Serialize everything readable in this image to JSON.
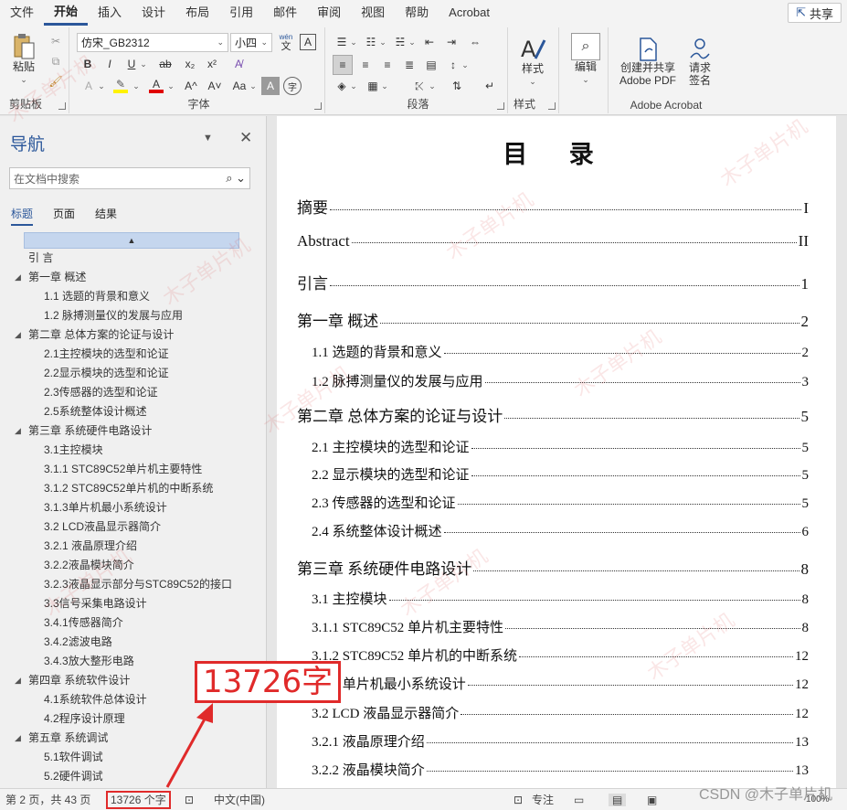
{
  "menubar": {
    "items": [
      "文件",
      "开始",
      "插入",
      "设计",
      "布局",
      "引用",
      "邮件",
      "审阅",
      "视图",
      "帮助",
      "Acrobat"
    ],
    "active": "开始",
    "share_label": "共享"
  },
  "ribbon": {
    "clipboard": {
      "paste_label": "粘贴",
      "group_label": "剪贴板"
    },
    "font": {
      "family": "仿宋_GB2312",
      "size": "小四",
      "group_label": "字体",
      "wen_label": "wén",
      "wen_char": "文",
      "a_box": "A",
      "bold": "B",
      "italic": "I",
      "underline": "U",
      "strike": "ab",
      "sub": "x₂",
      "sup": "x²",
      "grow": "A^",
      "shrink": "A˅",
      "case": "Aa",
      "clear": "A",
      "highlight": "ab",
      "color": "A",
      "char_shade": "A",
      "enclose": "字"
    },
    "paragraph": {
      "group_label": "段落"
    },
    "styles": {
      "label": "样式",
      "group_label": "样式"
    },
    "editing": {
      "label": "编辑"
    },
    "adobe": {
      "create_label_1": "创建并共享",
      "create_label_2": "Adobe PDF",
      "sign_label_1": "请求",
      "sign_label_2": "签名",
      "group_label": "Adobe Acrobat"
    }
  },
  "nav": {
    "title": "导航",
    "search_placeholder": "在文档中搜索",
    "tabs": [
      "标题",
      "页面",
      "结果"
    ],
    "items": [
      {
        "label": "引 言",
        "level": 1,
        "collapsible": false
      },
      {
        "label": "第一章 概述",
        "level": 1,
        "collapsible": true
      },
      {
        "label": "1.1 选题的背景和意义",
        "level": 2,
        "collapsible": false
      },
      {
        "label": "1.2 脉搏测量仪的发展与应用",
        "level": 2,
        "collapsible": false
      },
      {
        "label": "第二章 总体方案的论证与设计",
        "level": 1,
        "collapsible": true
      },
      {
        "label": "2.1主控模块的选型和论证",
        "level": 2,
        "collapsible": false
      },
      {
        "label": "2.2显示模块的选型和论证",
        "level": 2,
        "collapsible": false
      },
      {
        "label": "2.3传感器的选型和论证",
        "level": 2,
        "collapsible": false
      },
      {
        "label": "2.5系统整体设计概述",
        "level": 2,
        "collapsible": false
      },
      {
        "label": "第三章 系统硬件电路设计",
        "level": 1,
        "collapsible": true
      },
      {
        "label": "3.1主控模块",
        "level": 2,
        "collapsible": false
      },
      {
        "label": "3.1.1 STC89C52单片机主要特性",
        "level": 2,
        "collapsible": false
      },
      {
        "label": "3.1.2 STC89C52单片机的中断系统",
        "level": 2,
        "collapsible": false
      },
      {
        "label": "3.1.3单片机最小系统设计",
        "level": 2,
        "collapsible": false
      },
      {
        "label": "3.2 LCD液晶显示器简介",
        "level": 2,
        "collapsible": false
      },
      {
        "label": "3.2.1 液晶原理介绍",
        "level": 2,
        "collapsible": false
      },
      {
        "label": "3.2.2液晶模块简介",
        "level": 2,
        "collapsible": false
      },
      {
        "label": "3.2.3液晶显示部分与STC89C52的接口",
        "level": 2,
        "collapsible": false
      },
      {
        "label": "3.3信号采集电路设计",
        "level": 2,
        "collapsible": false
      },
      {
        "label": "3.4.1传感器简介",
        "level": 2,
        "collapsible": false
      },
      {
        "label": "3.4.2滤波电路",
        "level": 2,
        "collapsible": false
      },
      {
        "label": "3.4.3放大整形电路",
        "level": 2,
        "collapsible": false
      },
      {
        "label": "第四章 系统软件设计",
        "level": 1,
        "collapsible": true
      },
      {
        "label": "4.1系统软件总体设计",
        "level": 2,
        "collapsible": false
      },
      {
        "label": "4.2程序设计原理",
        "level": 2,
        "collapsible": false
      },
      {
        "label": "第五章 系统调试",
        "level": 1,
        "collapsible": true
      },
      {
        "label": "5.1软件调试",
        "level": 2,
        "collapsible": false
      },
      {
        "label": "5.2硬件调试",
        "level": 2,
        "collapsible": false
      }
    ]
  },
  "document": {
    "title": "目 录",
    "toc": [
      {
        "text": "摘要",
        "page": "I",
        "level": 1
      },
      {
        "text": "Abstract",
        "page": "II",
        "level": 1
      },
      {
        "text": "引言",
        "page": "1",
        "level": 1
      },
      {
        "text": "第一章  概述",
        "page": "2",
        "level": 1
      },
      {
        "text": "1.1 选题的背景和意义",
        "page": "2",
        "level": 2
      },
      {
        "text": "1.2 脉搏测量仪的发展与应用",
        "page": "3",
        "level": 2
      },
      {
        "text": "第二章  总体方案的论证与设计",
        "page": "5",
        "level": 1
      },
      {
        "text": "2.1 主控模块的选型和论证",
        "page": "5",
        "level": 2
      },
      {
        "text": "2.2 显示模块的选型和论证",
        "page": "5",
        "level": 2
      },
      {
        "text": "2.3 传感器的选型和论证",
        "page": "5",
        "level": 2
      },
      {
        "text": "2.4 系统整体设计概述",
        "page": "6",
        "level": 2
      },
      {
        "text": "第三章  系统硬件电路设计",
        "page": "8",
        "level": 1
      },
      {
        "text": "3.1 主控模块",
        "page": "8",
        "level": 2
      },
      {
        "text": "3.1.1 STC89C52 单片机主要特性",
        "page": "8",
        "level": 2
      },
      {
        "text": "3.1.2 STC89C52 单片机的中断系统",
        "page": "12",
        "level": 2
      },
      {
        "text": "3.1.3 单片机最小系统设计",
        "page": "12",
        "level": 2
      },
      {
        "text": "3.2 LCD 液晶显示器简介",
        "page": "12",
        "level": 2
      },
      {
        "text": "3.2.1 液晶原理介绍",
        "page": "13",
        "level": 2
      },
      {
        "text": "3.2.2 液晶模块简介",
        "page": "13",
        "level": 2
      }
    ]
  },
  "status": {
    "page_info": "第 2 页，共 43 页",
    "word_count": "13726 个字",
    "language": "中文(中国)",
    "focus_label": "专注",
    "zoom": "100%"
  },
  "annotation": {
    "text": "13726字"
  },
  "watermark": {
    "text": "木子单片机",
    "csdn": "CSDN @木子单片机"
  },
  "colors": {
    "accent": "#2b579a",
    "annotation": "#e02a2a"
  }
}
